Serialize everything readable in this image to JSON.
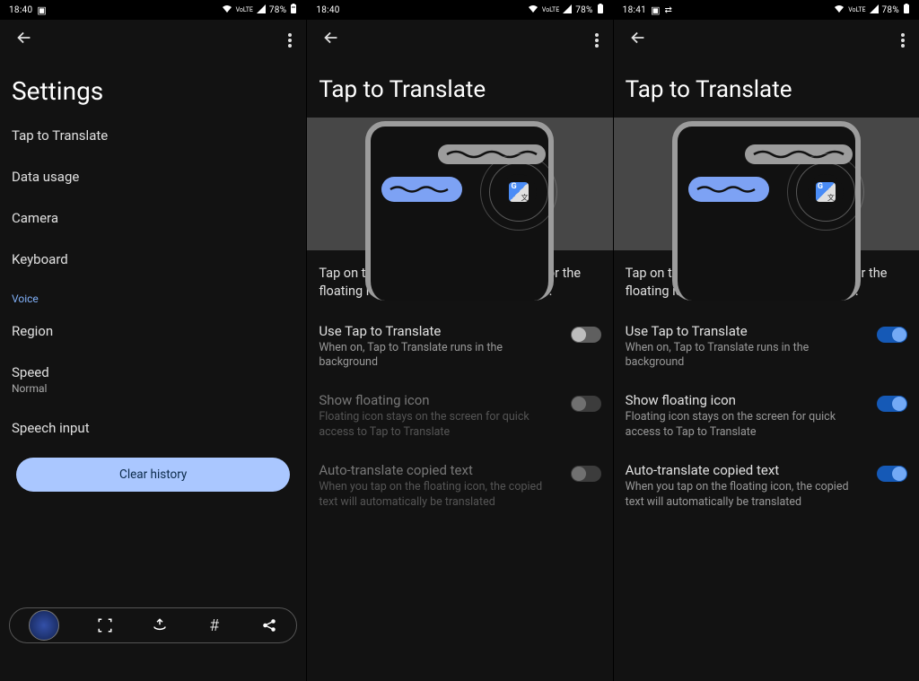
{
  "panel1": {
    "status": {
      "time": "18:40",
      "battery": "78%",
      "network": "VoLTE"
    },
    "title": "Settings",
    "items": {
      "tap_to_translate": "Tap to Translate",
      "data_usage": "Data usage",
      "camera": "Camera",
      "keyboard": "Keyboard"
    },
    "voice_header": "Voice",
    "voice": {
      "region": "Region",
      "speed_label": "Speed",
      "speed_value": "Normal",
      "speech_input": "Speech input"
    },
    "clear_history": "Clear history"
  },
  "panel2": {
    "status": {
      "time": "18:40",
      "battery": "78%",
      "network": "VoLTE"
    },
    "title": "Tap to Translate",
    "desc": "Tap on the Tap to Translate notification or the floating icon to translate from anywhere.",
    "settings": {
      "use": {
        "title": "Use Tap to Translate",
        "sub": "When on, Tap to Translate runs in the background",
        "on": false,
        "disabled": false
      },
      "show": {
        "title": "Show floating icon",
        "sub": "Floating icon stays on the screen for quick access to Tap to Translate",
        "on": false,
        "disabled": true
      },
      "auto": {
        "title": "Auto-translate copied text",
        "sub": "When you tap on the floating icon, the copied text will automatically be translated",
        "on": false,
        "disabled": true
      }
    }
  },
  "panel3": {
    "status": {
      "time": "18:41",
      "battery": "78%",
      "network": "VoLTE"
    },
    "title": "Tap to Translate",
    "desc": "Tap on the Tap to Translate notification or the floating icon to translate from anywhere.",
    "settings": {
      "use": {
        "title": "Use Tap to Translate",
        "sub": "When on, Tap to Translate runs in the background",
        "on": true,
        "disabled": false
      },
      "show": {
        "title": "Show floating icon",
        "sub": "Floating icon stays on the screen for quick access to Tap to Translate",
        "on": true,
        "disabled": false
      },
      "auto": {
        "title": "Auto-translate copied text",
        "sub": "When you tap on the floating icon, the copied text will automatically be translated",
        "on": true,
        "disabled": false
      }
    }
  }
}
